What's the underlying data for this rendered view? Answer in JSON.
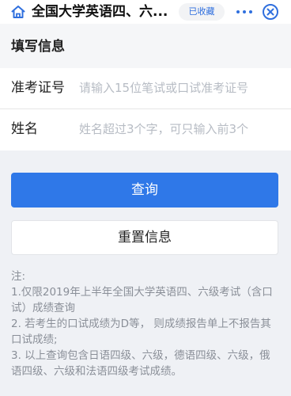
{
  "header": {
    "title": "全国大学英语四、六...",
    "favorite_label": "已收藏",
    "icons": [
      "home-icon",
      "more-icon",
      "close-icon"
    ]
  },
  "section": {
    "title": "填写信息"
  },
  "form": {
    "exam_id": {
      "label": "准考证号",
      "placeholder": "请输入15位笔试或口试准考证号",
      "value": ""
    },
    "name": {
      "label": "姓名",
      "placeholder": "姓名超过3个字，可只输入前3个",
      "value": ""
    }
  },
  "actions": {
    "query_label": "查询",
    "reset_label": "重置信息"
  },
  "notes": {
    "title": "注:",
    "items": [
      "1.仅限2019年上半年全国大学英语四、六级考试（含口试）成绩查询",
      "2. 若考生的口试成绩为D等， 则成绩报告单上不报告其口试成绩;",
      "3. 以上查询包含日语四级、六级，德语四级、六级，俄语四级、六级和法语四级考试成绩。"
    ]
  },
  "colors": {
    "accent": "#2f78e8",
    "background": "#eff1f5",
    "placeholder": "#b7bcc4",
    "note_text": "#8a8f98"
  }
}
